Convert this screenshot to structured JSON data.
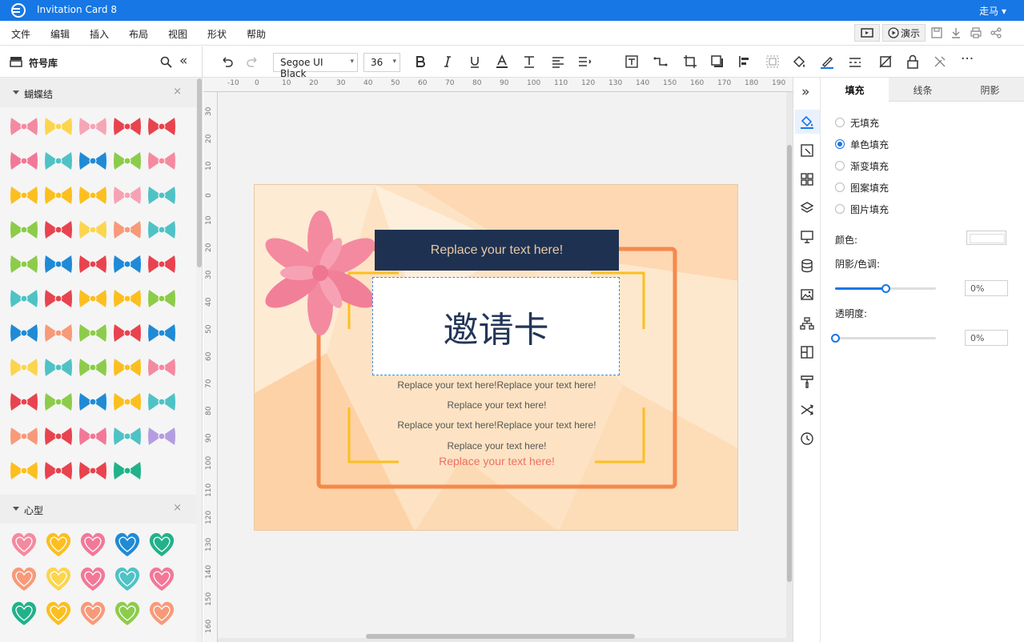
{
  "window": {
    "title": "Invitation Card 8",
    "user": "走马",
    "user_caret": "▾"
  },
  "menu": {
    "items": [
      "文件",
      "编辑",
      "插入",
      "布局",
      "视图",
      "形状",
      "帮助"
    ]
  },
  "menu_right": {
    "present_label": "演示"
  },
  "toolbar": {
    "font_family": "Segoe UI Black",
    "font_size": "36",
    "caret": "▾",
    "more": "···"
  },
  "library": {
    "title": "符号库",
    "collapse_glyph": "«",
    "sections": [
      {
        "title": "蝴蝶结",
        "close": "×"
      },
      {
        "title": "心型",
        "close": "×"
      }
    ]
  },
  "ruler": {
    "top_ticks": [
      "-10",
      "0",
      "10",
      "20",
      "30",
      "40",
      "50",
      "60",
      "70",
      "80",
      "90",
      "100",
      "110",
      "120",
      "130",
      "140",
      "150",
      "160",
      "170",
      "180",
      "190"
    ],
    "left_ticks": [
      "30",
      "20",
      "10",
      "0",
      "10",
      "20",
      "30",
      "40",
      "50",
      "60",
      "70",
      "80",
      "90",
      "100",
      "110",
      "120",
      "130",
      "140",
      "150",
      "160"
    ]
  },
  "card": {
    "header": "Replace your text here!",
    "title": "邀请卡",
    "lines": [
      "Replace your text here!Replace your text here!",
      "Replace your text here!",
      "Replace your text here!Replace your text here!",
      "Replace your text here!"
    ],
    "accent": "Replace your text here!"
  },
  "strip_collapse": "»",
  "props": {
    "tabs": [
      "填充",
      "线条",
      "阴影"
    ],
    "fill_options": [
      "无填充",
      "单色填充",
      "渐变填充",
      "图案填充",
      "图片填充"
    ],
    "selected_fill": 1,
    "color_label": "颜色:",
    "shade_label": "阴影/色调:",
    "shade_value": "0%",
    "shade_level": 0.5,
    "opacity_label": "透明度:",
    "opacity_value": "0%",
    "opacity_level": 0
  },
  "colors": {
    "accent": "#1677e5",
    "navy": "#1f3151",
    "peach": "#fde3c3",
    "frame_orange": "#f5894b",
    "frame_yellow": "#fbbf1f",
    "ribbon_pink": "#f48aa0"
  }
}
